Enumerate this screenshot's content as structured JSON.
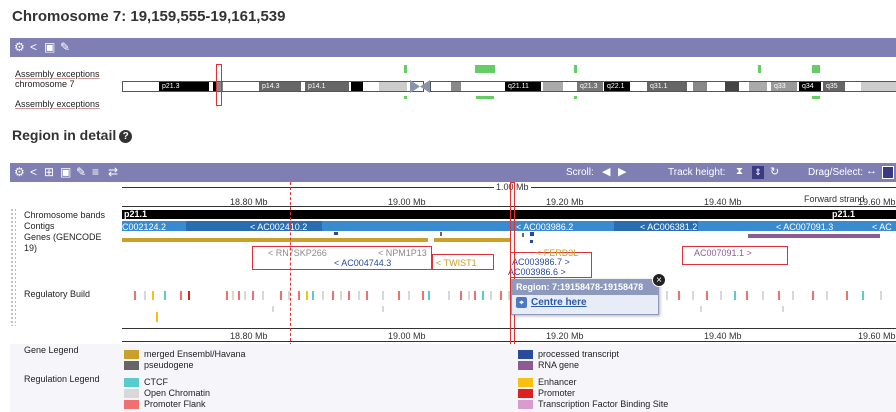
{
  "page": {
    "title": "Chromosome 7: 19,159,555-19,161,539",
    "subtitle": "Region in detail"
  },
  "overview": {
    "track_labels": [
      "Assembly exceptions",
      "chromosome 7",
      "Assembly exceptions"
    ],
    "bands": [
      {
        "label": "p21.3",
        "color": "#000000"
      },
      {
        "label": "p14.3",
        "color": "#666666"
      },
      {
        "label": "p14.1",
        "color": "#666666"
      },
      {
        "label": "q21.11",
        "color": "#000000"
      },
      {
        "label": "q21.3",
        "color": "#777777"
      },
      {
        "label": "q22.1",
        "color": "#000000"
      },
      {
        "label": "q31.1",
        "color": "#666666"
      },
      {
        "label": "q33",
        "color": "#999999"
      },
      {
        "label": "q34",
        "color": "#000000"
      },
      {
        "label": "q35",
        "color": "#666666"
      }
    ]
  },
  "detail": {
    "toolbar": {
      "scroll_label": "Scroll:",
      "track_height_label": "Track height:",
      "drag_select_label": "Drag/Select:"
    },
    "scale_label": "1.00 Mb",
    "strand_label": "Forward strand",
    "ruler_ticks": [
      "18.80 Mb",
      "19.00 Mb",
      "19.20 Mb",
      "19.40 Mb",
      "19.60 Mb"
    ],
    "track_labels": {
      "chromosome_bands": "Chromosome bands",
      "contigs": "Contigs",
      "genes": "Genes (GENCODE 19)",
      "regulatory": "Regulatory Build"
    },
    "band_labels": [
      "p21.1",
      "p21.1"
    ],
    "contigs": [
      "C002124.2",
      "< AC002410.2",
      "< AC003986.2",
      "< AC006381.2",
      "< AC007091.3",
      "< AC"
    ],
    "genes": [
      "< RN7SKP266",
      "< NPM1P13",
      "< AC004744.3",
      "< TWIST1",
      "< FERD3L",
      "AC003986.7 >",
      "AC003986.6 >",
      "AC007091.1 >"
    ],
    "popup": {
      "header": "Region: 7:19158478-19158478",
      "link": "Centre here"
    }
  },
  "legend": {
    "gene_title": "Gene Legend",
    "regulation_title": "Regulation Legend",
    "gene_items": [
      {
        "label": "merged Ensembl/Havana",
        "color": "#c8a02a"
      },
      {
        "label": "pseudogene",
        "color": "#666666"
      },
      {
        "label": "processed transcript",
        "color": "#2a4a9a"
      },
      {
        "label": "RNA gene",
        "color": "#8e5a96"
      }
    ],
    "regulation_items": [
      {
        "label": "CTCF",
        "color": "#58cccc"
      },
      {
        "label": "Open Chromatin",
        "color": "#d8d8d8"
      },
      {
        "label": "Promoter Flank",
        "color": "#f07070"
      },
      {
        "label": "Enhancer",
        "color": "#f8c010"
      },
      {
        "label": "Promoter",
        "color": "#e02020"
      },
      {
        "label": "Transcription Factor Binding Site",
        "color": "#d89cd0"
      }
    ]
  }
}
